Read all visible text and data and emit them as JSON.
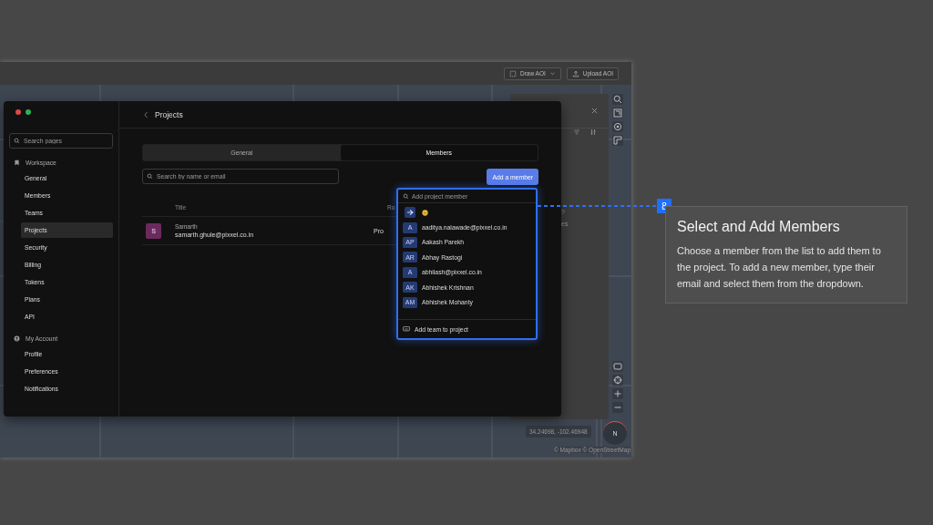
{
  "toolbar": {
    "buttons": [
      {
        "label": "Draw AOI",
        "kind": "dropdown"
      },
      {
        "label": "Upload AOI",
        "kind": "upload"
      }
    ]
  },
  "back_panel": {
    "texts": [
      "?",
      "es"
    ]
  },
  "map": {
    "coordinates": "34.24698, -102.46948",
    "compass": "N",
    "attribution": "© Mapbox © OpenStreetMap"
  },
  "settings": {
    "search": {
      "placeholder": "Search pages"
    },
    "sections": [
      {
        "title": "Workspace",
        "kind": "workspace",
        "items": [
          {
            "label": "General",
            "selected": false
          },
          {
            "label": "Members",
            "selected": false
          },
          {
            "label": "Teams",
            "selected": false
          },
          {
            "label": "Projects",
            "selected": true
          },
          {
            "label": "Security",
            "selected": false
          },
          {
            "label": "Billing",
            "selected": false
          },
          {
            "label": "Tokens",
            "selected": false
          },
          {
            "label": "Plans",
            "selected": false
          },
          {
            "label": "API",
            "selected": false
          }
        ]
      },
      {
        "title": "My Account",
        "kind": "account",
        "items": [
          {
            "label": "Profile",
            "selected": false
          },
          {
            "label": "Preferences",
            "selected": false
          },
          {
            "label": "Notifications",
            "selected": false
          }
        ]
      }
    ],
    "page_title": "Projects",
    "tabs": [
      {
        "label": "General",
        "selected": false
      },
      {
        "label": "Members",
        "selected": true
      }
    ],
    "member_search": {
      "placeholder": "Search by name or email"
    },
    "add_button": "Add a member",
    "table": {
      "columns": [
        "Title",
        "Ro"
      ],
      "rows": [
        {
          "initial": "S",
          "color": "#6b2a5e",
          "name": "Samarth",
          "email": "samarth.ghule@pixxel.co.in",
          "column_2": "Pro"
        }
      ]
    }
  },
  "dropdown": {
    "placeholder": "Add project member",
    "options": [
      {
        "kind": "emoji"
      },
      {
        "kind": "person",
        "initials": "A",
        "label": "aaditya.nalawade@pixxel.co.in"
      },
      {
        "kind": "person",
        "initials": "AP",
        "label": "Aakash Parekh"
      },
      {
        "kind": "person",
        "initials": "AR",
        "label": "Abhay Rastogi"
      },
      {
        "kind": "person",
        "initials": "A",
        "label": "abhilash@pixxel.co.in"
      },
      {
        "kind": "person",
        "initials": "AK",
        "label": "Abhishek Krishnan"
      },
      {
        "kind": "person",
        "initials": "AM",
        "label": "Abhishek Mohanty"
      }
    ],
    "footer": "Add team to project"
  },
  "callout": {
    "step": "8",
    "title": "Select and Add Members",
    "body": "Choose a member from the list to add them to the project. To add a new member, type their email and select them from the dropdown."
  }
}
